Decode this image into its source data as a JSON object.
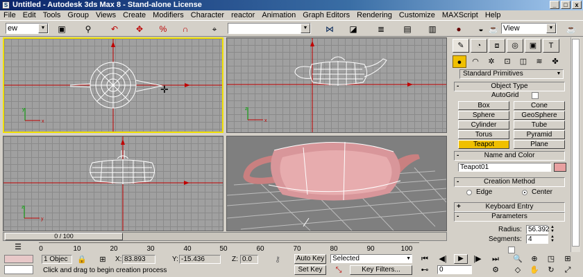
{
  "window": {
    "title": "Untitled - Autodesk 3ds Max 8 - Stand-alone License",
    "controls": [
      "_",
      "□",
      "x"
    ]
  },
  "menu": [
    "File",
    "Edit",
    "Tools",
    "Group",
    "Views",
    "Create",
    "Modifiers",
    "Character",
    "reactor",
    "Animation",
    "Graph Editors",
    "Rendering",
    "Customize",
    "MAXScript",
    "Help"
  ],
  "toolbar": {
    "selection_filter": "ew",
    "named_selection": "",
    "reference_coord": "View"
  },
  "command_panel": {
    "category_dropdown": "Standard Primitives",
    "object_type": {
      "title": "Object Type",
      "autogrid_label": "AutoGrid",
      "buttons": [
        "Box",
        "Cone",
        "Sphere",
        "GeoSphere",
        "Cylinder",
        "Tube",
        "Torus",
        "Pyramid",
        "Teapot",
        "Plane"
      ],
      "active": "Teapot"
    },
    "name_color": {
      "title": "Name and Color",
      "name": "Teapot01",
      "color": "#e8a0a0"
    },
    "creation_method": {
      "title": "Creation Method",
      "options": [
        "Edge",
        "Center"
      ],
      "selected": "Center"
    },
    "keyboard_entry": {
      "title": "Keyboard Entry"
    },
    "parameters": {
      "title": "Parameters",
      "radius_label": "Radius:",
      "radius_value": "56.392",
      "segments_label": "Segments:",
      "segments_value": "4"
    }
  },
  "timeline": {
    "slider_label": "0 / 100",
    "ticks": [
      "0",
      "10",
      "20",
      "30",
      "40",
      "50",
      "60",
      "70",
      "80",
      "90",
      "100"
    ]
  },
  "status": {
    "selection_count": "1 Objec",
    "x_label": "X:",
    "x_value": "83.893",
    "y_label": "Y:",
    "y_value": "-15.436",
    "z_label": "Z:",
    "z_value": "0.0",
    "prompt": "Click and drag to begin creation process",
    "autokey_label": "Auto Key",
    "setkey_label": "Set Key",
    "key_mode": "Selected",
    "key_filters": "Key Filters...",
    "frame": "0"
  }
}
